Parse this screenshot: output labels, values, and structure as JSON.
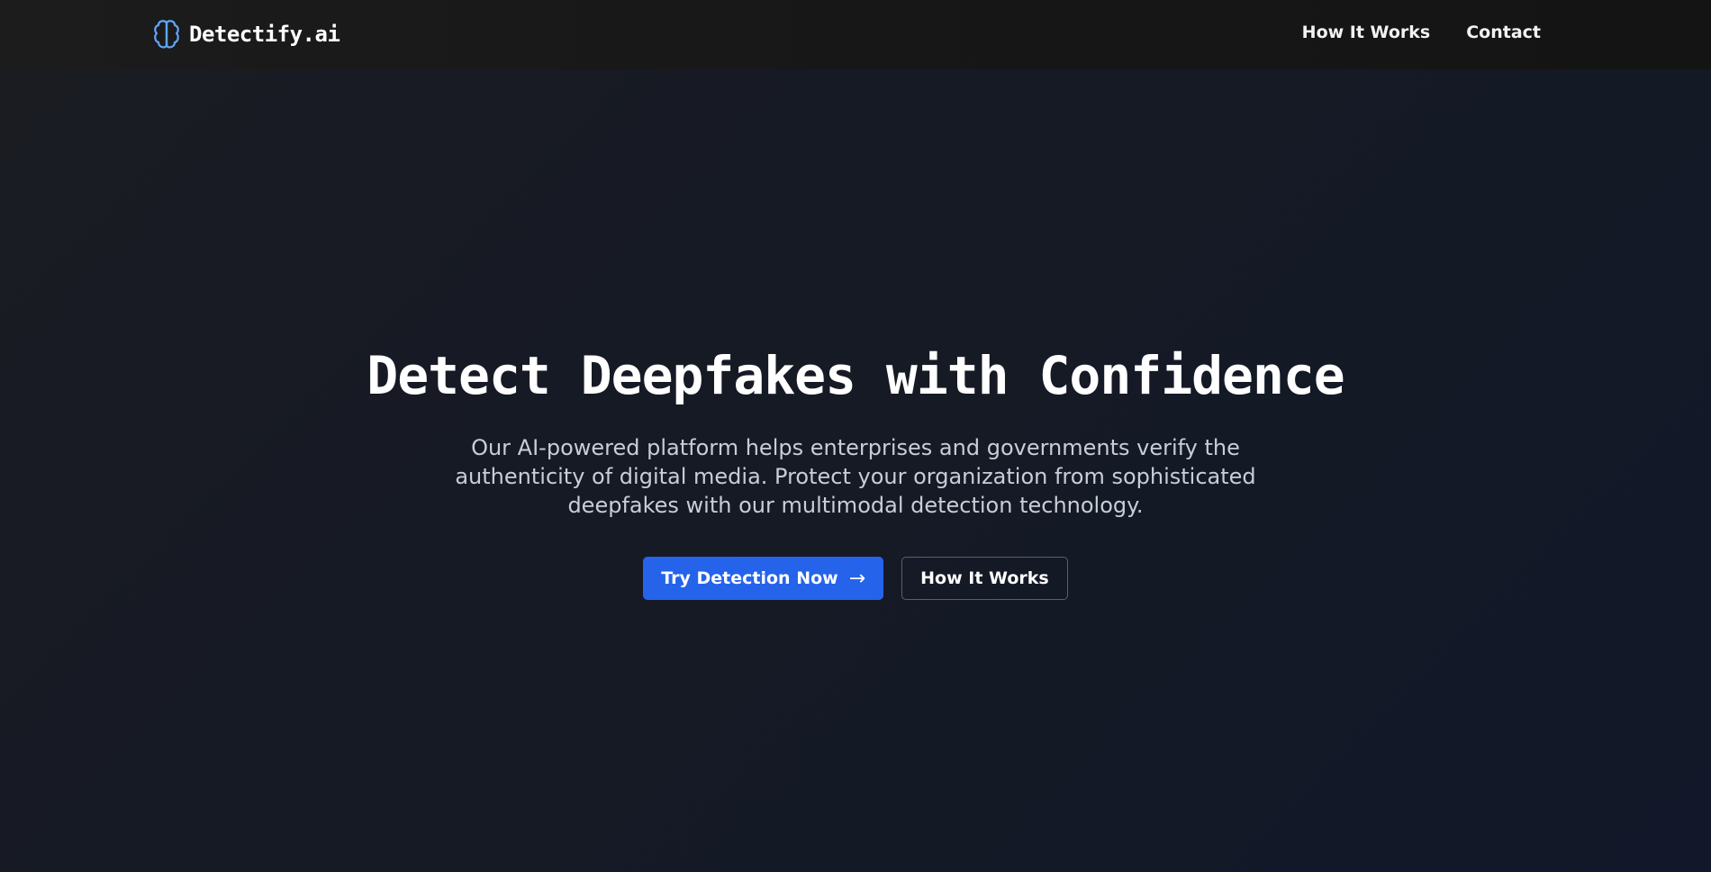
{
  "navbar": {
    "brand_name": "Detectify.ai",
    "brand_icon": "brain-icon",
    "links": [
      {
        "label": "How It Works"
      },
      {
        "label": "Contact"
      }
    ]
  },
  "hero": {
    "title": "Detect Deepfakes with Confidence",
    "subtitle": "Our AI-powered platform helps enterprises and governments verify the authenticity of digital media. Protect your organization from sophisticated deepfakes with our multimodal detection technology.",
    "primary_button": {
      "label": "Try Detection Now",
      "icon": "arrow-right-icon",
      "arrow_glyph": "→"
    },
    "secondary_button": {
      "label": "How It Works"
    }
  },
  "colors": {
    "accent": "#2563eb",
    "brand_icon": "#60a5fa",
    "background": "#151a26",
    "navbar": "#181818",
    "subtitle_text": "#c9cdd6"
  }
}
